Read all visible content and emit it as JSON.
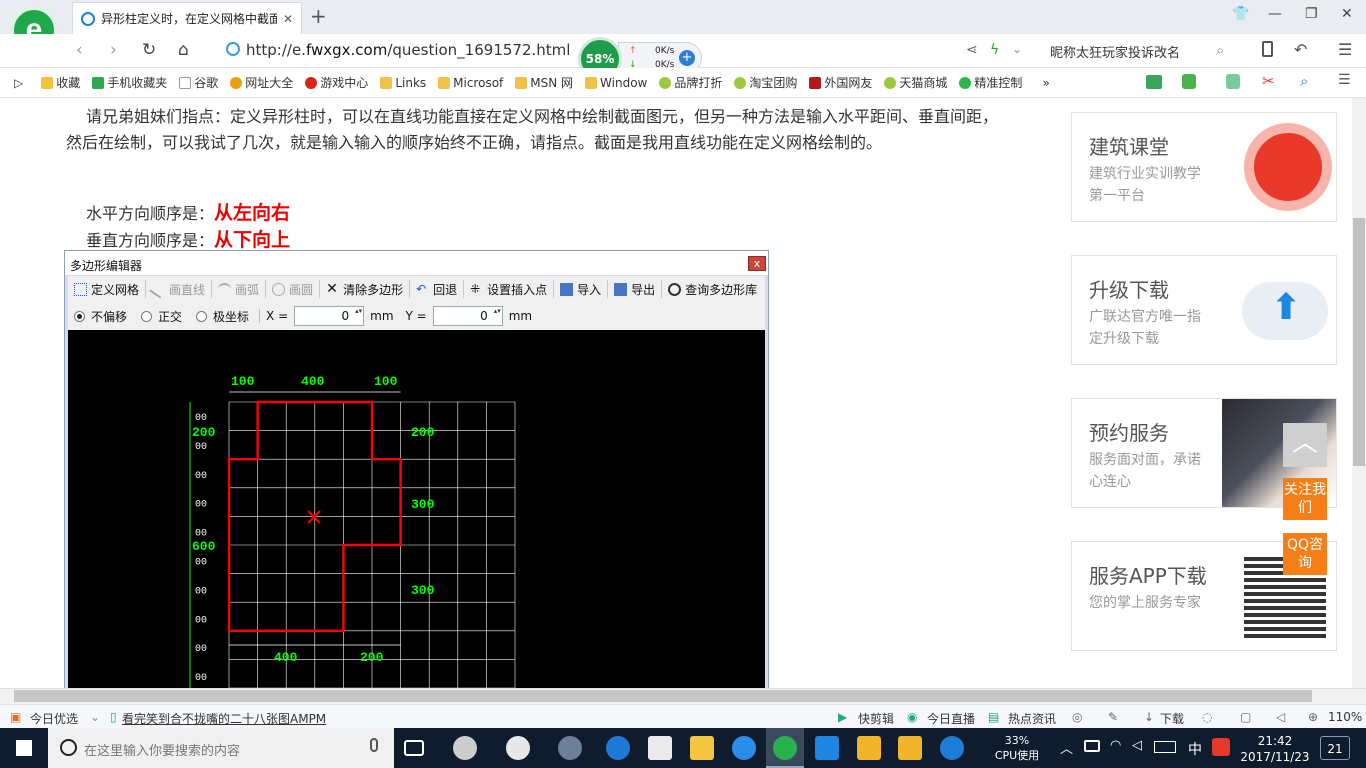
{
  "browser": {
    "tab_title": "异形柱定义时，在定义网格中截面",
    "url_prefix": "http://e.",
    "url_domain": "fwxgx.com",
    "url_path": "/question_1691572.html",
    "speed_percent": "58%",
    "upload_speed": "0K/s",
    "download_speed": "0K/s",
    "search_text": "昵称太狂玩家投诉改名"
  },
  "bookmarks": [
    "收藏",
    "手机收藏夹",
    "谷歌",
    "网址大全",
    "游戏中心",
    "Links",
    "Microsof",
    "MSN 网",
    "Window",
    "品牌打折",
    "淘宝团购",
    "外国网友",
    "天猫商城",
    "精准控制"
  ],
  "article": {
    "paragraph": "请兄弟姐妹们指点：定义异形柱时，可以在直线功能直接在定义网格中绘制截面图元，但另一种方法是输入水平距间、垂直间距，然后在绘制，可以我试了几次，就是输入输入的顺序始终不正确，请指点。截面是我用直线功能在定义网格绘制的。",
    "h_label": "水平方向顺序是：",
    "h_value": "从左向右",
    "v_label": "垂直方向顺序是：",
    "v_value": "从下向上"
  },
  "editor": {
    "title": "多边形编辑器",
    "toolbar": [
      "定义网格",
      "画直线",
      "画弧",
      "画圆",
      "清除多边形",
      "回退",
      "设置插入点",
      "导入",
      "导出",
      "查询多边形库"
    ],
    "opt_no_offset": "不偏移",
    "opt_ortho": "正交",
    "opt_polar": "极坐标",
    "x_label": "X =",
    "x_value": "0",
    "y_label": "Y =",
    "y_value": "0",
    "unit": "mm",
    "dims_top": [
      "100",
      "400",
      "100"
    ],
    "dims_bottom": [
      "400",
      "200"
    ],
    "dims_left": [
      "200",
      "600"
    ],
    "dims_right": [
      "200",
      "300",
      "300"
    ],
    "row_marks": [
      "00",
      "00",
      "00",
      "00",
      "00",
      "00",
      "00",
      "00",
      "00",
      "00"
    ],
    "grid_color": "#ffffff",
    "dim_color": "#00ff00",
    "shape_color": "#ff0000"
  },
  "sidebar": [
    {
      "title": "建筑课堂",
      "desc": "建筑行业实训教学第一平台",
      "icon": "red-logo-icon"
    },
    {
      "title": "升级下载",
      "desc": "广联达官方唯一指定升级下载",
      "icon": "cloud-upload-icon"
    },
    {
      "title": "预约服务",
      "desc": "服务面对面，承诺心连心",
      "icon": "handshake-photo"
    },
    {
      "title": "服务APP下载",
      "desc": "您的掌上服务专家",
      "icon": "qr-code-icon"
    }
  ],
  "float": {
    "follow": "关注我们",
    "qq": "QQ咨询"
  },
  "statusbar": {
    "news": "今日优选",
    "headline": "看完笑到合不拢嘴的二十八张图AMPM",
    "quick_edit": "快剪辑",
    "live": "今日直播",
    "hot": "热点资讯",
    "download": "下载",
    "zoom": "110%"
  },
  "taskbar": {
    "search_placeholder": "在这里输入你要搜索的内容",
    "cpu_percent": "33%",
    "cpu_label": "CPU使用",
    "ime": "中",
    "time": "21:42",
    "date": "2017/11/23",
    "notif_count": "21"
  }
}
